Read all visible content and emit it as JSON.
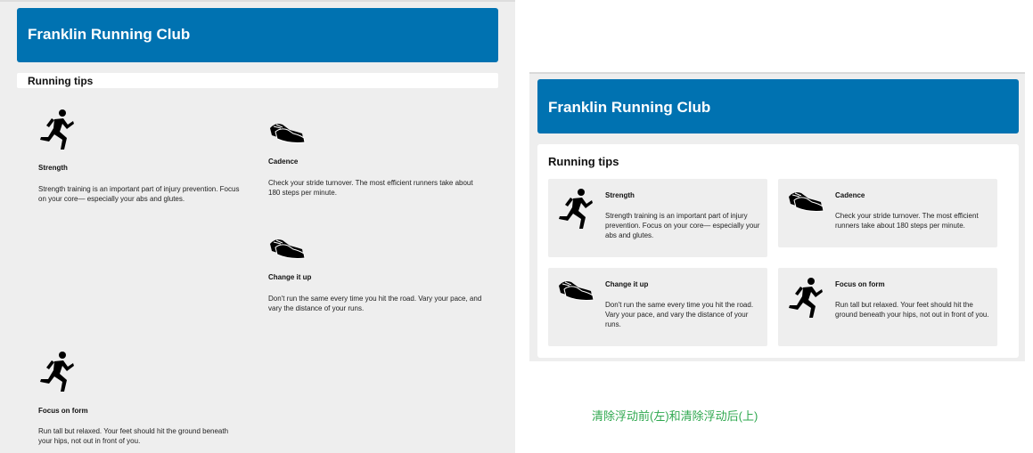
{
  "left_panel": {
    "header": {
      "title": "Franklin Running Club"
    },
    "section_title": "Running tips",
    "tips": [
      {
        "title": "Strength",
        "desc": "Strength training is an important part of injury prevention. Focus on your core— especially your abs and glutes.",
        "icon": "runner-icon"
      },
      {
        "title": "Cadence",
        "desc": "Check your stride turnover. The most efficient runners take about 180 steps per minute.",
        "icon": "running-shoes-icon"
      },
      {
        "title": "Change it up",
        "desc": "Don't run the same every time you hit the road. Vary your pace, and vary the distance of your runs.",
        "icon": "running-shoes-icon"
      },
      {
        "title": "Focus on form",
        "desc": "Run tall but relaxed. Your feet should hit the ground beneath your hips, not out in front of you.",
        "icon": "runner-icon"
      }
    ]
  },
  "right_panel": {
    "header": {
      "title": "Franklin Running Club"
    },
    "section_title": "Running tips",
    "tips": [
      {
        "title": "Strength",
        "desc": "Strength training is an important part of injury prevention. Focus on your core— especially your abs and glutes.",
        "icon": "runner-icon"
      },
      {
        "title": "Cadence",
        "desc": "Check your stride turnover. The most efficient runners take about 180 steps per minute.",
        "icon": "running-shoes-icon"
      },
      {
        "title": "Change it up",
        "desc": "Don't run the same every time you hit the road. Vary your pace, and vary the distance of your runs.",
        "icon": "running-shoes-icon"
      },
      {
        "title": "Focus on form",
        "desc": "Run tall but relaxed. Your feet should hit the ground beneath your hips, not out in front of you.",
        "icon": "runner-icon"
      }
    ]
  },
  "caption": "清除浮动前(左)和清除浮动后(上)",
  "colors": {
    "header_bg": "#0072b1",
    "panel_bg": "#eeeeee",
    "caption": "#2fa84f"
  }
}
